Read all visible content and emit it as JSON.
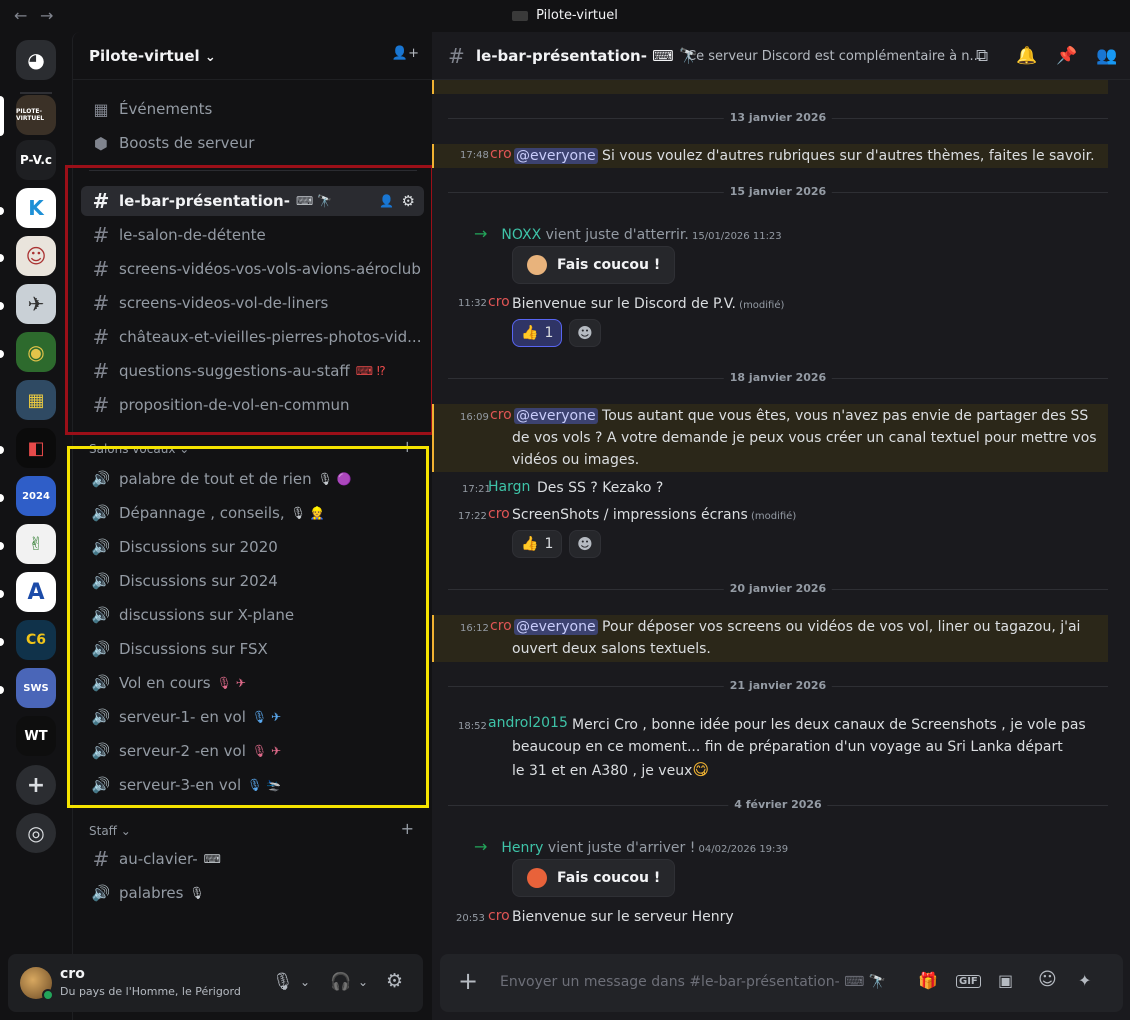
{
  "titlebar": {
    "back": "←",
    "forward": "→",
    "title": "Pilote-virtuel"
  },
  "rail": {
    "discord_label": "◕",
    "servers": [
      "PILOTE-VIRTUEL",
      "P-V.c",
      "K",
      "☺",
      "✈",
      "◉",
      "▦",
      "◧",
      "2024",
      "✌",
      "A",
      "C6",
      "SWS",
      "WT"
    ],
    "add": "+",
    "explore": "◎"
  },
  "sidebar": {
    "guild_name": "Pilote-virtuel",
    "guild_chevron": "⌄",
    "invite_icon": "👤+",
    "top_items": [
      {
        "icon": "▦",
        "label": "Événements"
      },
      {
        "icon": "⬢",
        "label": "Boosts de serveur"
      }
    ],
    "text_channels": [
      {
        "label": "le-bar-présentation-",
        "emoji": "⌨ 🔭"
      },
      {
        "label": "le-salon-de-détente",
        "emoji": ""
      },
      {
        "label": "screens-vidéos-vos-vols-avions-aéroclub",
        "emoji": ""
      },
      {
        "label": "screens-videos-vol-de-liners",
        "emoji": ""
      },
      {
        "label": "châteaux-et-vieilles-pierres-photos-vid...",
        "emoji": ""
      },
      {
        "label": "questions-suggestions-au-staff",
        "emoji": "⌨ ⁉"
      },
      {
        "label": "proposition-de-vol-en-commun",
        "emoji": ""
      }
    ],
    "voice_category": "Salons vocaux",
    "voice_channels": [
      {
        "label": "palabre de tout et de rien",
        "emoji": "🎙 🟣"
      },
      {
        "label": "Dépannage , conseils,",
        "emoji": "🎙 👷"
      },
      {
        "label": "Discussions sur 2020",
        "emoji": ""
      },
      {
        "label": "Discussions sur 2024",
        "emoji": ""
      },
      {
        "label": "discussions sur X-plane",
        "emoji": ""
      },
      {
        "label": "Discussions sur FSX",
        "emoji": ""
      },
      {
        "label": "Vol en cours",
        "emoji": "🎙 ✈"
      },
      {
        "label": "serveur-1- en vol",
        "emoji": "🎙 ✈"
      },
      {
        "label": "serveur-2 -en vol",
        "emoji": "🎙 ✈"
      },
      {
        "label": "serveur-3-en vol",
        "emoji": "🎙 🛬"
      }
    ],
    "staff_category": "Staff",
    "staff_channels": [
      {
        "label": "au-clavier-",
        "emoji": "⌨"
      },
      {
        "label": "palabres",
        "emoji": "🎙"
      }
    ]
  },
  "user": {
    "name": "cro",
    "status": "Du pays de l'Homme, le Périgord",
    "mic": "🎙",
    "headset": "🎧",
    "settings": "⚙"
  },
  "channel": {
    "hash": "#",
    "title": "le-bar-présentation- ⌨ 🔭",
    "topic": "Ce serveur Discord est complémentaire à n...",
    "header_icons": [
      "⧉",
      "🔔",
      "📌",
      "👥"
    ]
  },
  "messages": {
    "d1": "13 janvier 2026",
    "m1": {
      "time": "17:48",
      "author": "cro",
      "mention": "@everyone",
      "text": " Si vous voulez d'autres rubriques sur d'autres thèmes, faites le savoir."
    },
    "d2": "15 janvier 2026",
    "j1": {
      "arrow": "→",
      "name": "NOXX",
      "text": " vient juste d'atterrir.",
      "time": " 15/01/2026 11:23",
      "button": "Fais coucou !"
    },
    "m2": {
      "time": "11:32",
      "author": "cro",
      "text": "Bienvenue sur le Discord de P.V.",
      "edited": " (modifié)",
      "reaction_emoji": "👍",
      "reaction_count": "1",
      "addreact": "☻"
    },
    "d3": "18 janvier 2026",
    "m3": {
      "time": "16:09",
      "author": "cro",
      "mention": "@everyone",
      "line1": " Tous autant que vous êtes, vous n'avez pas envie de partager des SS",
      "line2": "de vos vols ? A votre demande je peux vous créer un canal textuel pour mettre vos",
      "line3": "vidéos ou images."
    },
    "m4": {
      "time": "17:21",
      "author": "Hargn",
      "text": "Des SS ? Kezako ?"
    },
    "m5": {
      "time": "17:22",
      "author": "cro",
      "text": "ScreenShots / impressions écrans",
      "edited": " (modifié)",
      "reaction_emoji": "👍",
      "reaction_count": "1",
      "addreact": "☻"
    },
    "d4": "20 janvier 2026",
    "m6": {
      "time": "16:12",
      "author": "cro",
      "mention": "@everyone",
      "line1": " Pour déposer vos screens ou vidéos de vos vol, liner ou tagazou, j'ai",
      "line2": "ouvert deux salons textuels."
    },
    "d5": "21 janvier 2026",
    "m7": {
      "time": "18:52",
      "author": "androl2015",
      "line1": "Merci Cro , bonne idée pour les deux canaux de Screenshots  , je vole pas",
      "line2": "beaucoup en ce moment... fin de préparation d'un voyage au Sri Lanka départ",
      "line3": " le 31 et en A380 , je veux",
      "emoji": "😋"
    },
    "d6": "4 février 2026",
    "j2": {
      "arrow": "→",
      "name": "Henry",
      "text": " vient juste d'arriver !",
      "time": " 04/02/2026 19:39",
      "button": "Fais coucou !"
    },
    "m8": {
      "time": "20:53",
      "author": "cro",
      "text": "Bienvenue sur le serveur Henry"
    }
  },
  "composer": {
    "plus": "+",
    "placeholder": "Envoyer un message dans #le-bar-présentation- ⌨ 🔭",
    "icons": [
      "🎁",
      "GIF",
      "▣",
      "☺",
      "✦"
    ]
  },
  "colors": {
    "accent": "#5865f2",
    "mention_bg": "#2b2719",
    "highlight_red": "#9b0f18",
    "highlight_yellow": "#f5e400"
  }
}
